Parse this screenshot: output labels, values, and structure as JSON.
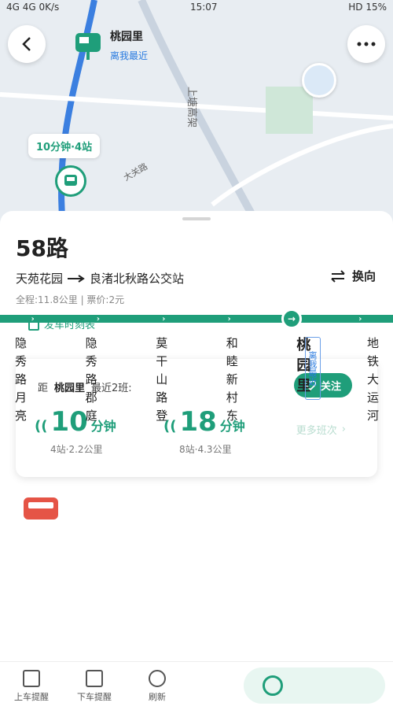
{
  "status": {
    "left": "4G 4G 0K/s",
    "time": "15:07",
    "right": "HD 15%"
  },
  "map": {
    "stop_name": "桃园里",
    "stop_sub": "离我最近",
    "bus_tag": "10分钟·4站",
    "road_label_1": "上塘高架",
    "road_label_2": "大关路"
  },
  "route": {
    "title": "58路",
    "from": "天苑花园",
    "to": "良渚北秋路公交站",
    "meta": "全程:11.8公里 | 票价:2元",
    "switch_label": "换向",
    "timetable_label": "发车时刻表"
  },
  "arrival": {
    "prefix": "距",
    "stop": "桃园里",
    "suffix": "最近2班:",
    "follow_label": "关注",
    "more_label": "更多班次",
    "buses": [
      {
        "minutes": "10",
        "unit": "分钟",
        "detail": "4站·2.2公里"
      },
      {
        "minutes": "18",
        "unit": "分钟",
        "detail": "8站·4.3公里"
      }
    ]
  },
  "stops": [
    "隐秀路月亮",
    "隐秀路郡庭",
    "莫干山路登",
    "和睦新村东",
    "桃园里",
    "地铁大运河"
  ],
  "current_stop_tag": "离我最近",
  "bottom": {
    "get_on": "上车提醒",
    "get_off": "下车提醒",
    "refresh": "刷新"
  },
  "colors": {
    "accent": "#1f9e7a",
    "route_blue": "#2a7be0"
  }
}
